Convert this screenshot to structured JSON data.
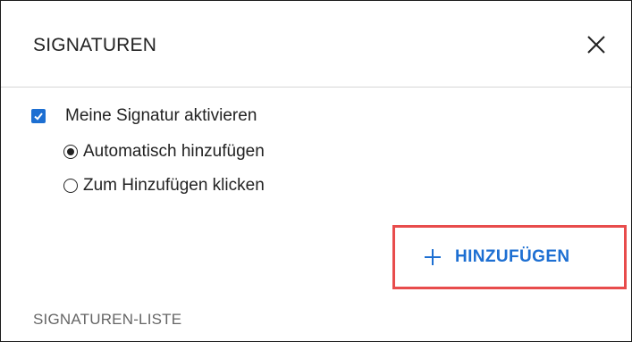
{
  "dialog": {
    "title": "SIGNATUREN",
    "close_icon": "close-icon"
  },
  "options": {
    "enable_label": "Meine Signatur aktivieren",
    "enable_checked": true,
    "auto_label": "Automatisch hinzufügen",
    "auto_selected": true,
    "click_label": "Zum Hinzufügen klicken",
    "click_selected": false
  },
  "add_button": {
    "label": "HINZUFÜGEN",
    "icon": "plus-icon"
  },
  "list": {
    "section_label": "SIGNATUREN-LISTE"
  },
  "colors": {
    "accent": "#1d6fd2",
    "highlight": "#e84c4c"
  }
}
